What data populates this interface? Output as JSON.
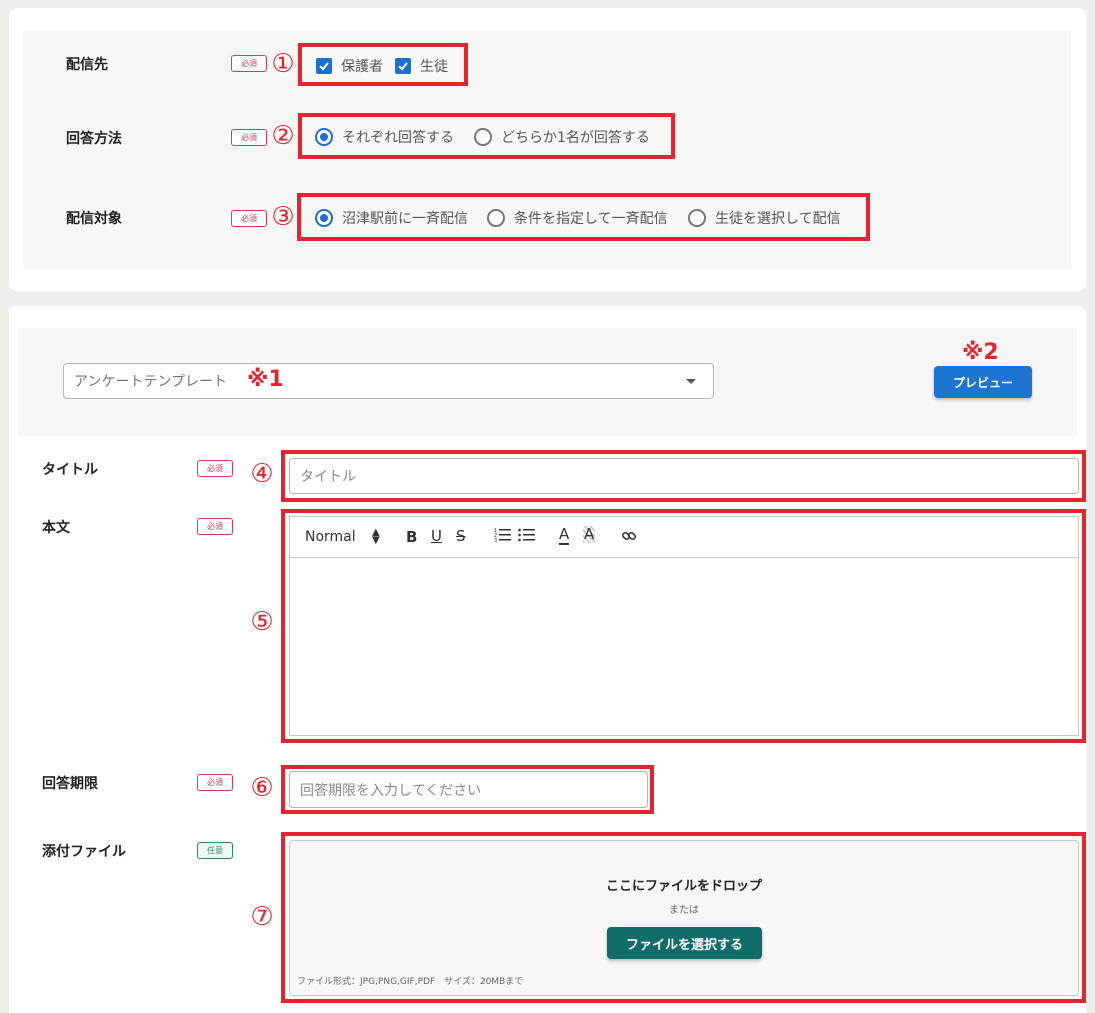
{
  "section1": {
    "rows": [
      {
        "label": "配信先",
        "badge": "必須",
        "num": "①"
      },
      {
        "label": "回答方法",
        "badge": "必須",
        "num": "②"
      },
      {
        "label": "配信対象",
        "badge": "必須",
        "num": "③"
      }
    ],
    "recipients": [
      {
        "label": "保護者",
        "checked": true
      },
      {
        "label": "生徒",
        "checked": true
      }
    ],
    "answer_methods": [
      {
        "label": "それぞれ回答する",
        "selected": true
      },
      {
        "label": "どちらか1名が回答する",
        "selected": false
      }
    ],
    "targets": [
      {
        "label": "沼津駅前に一斉配信",
        "selected": true
      },
      {
        "label": "条件を指定して一斉配信",
        "selected": false
      },
      {
        "label": "生徒を選択して配信",
        "selected": false
      }
    ]
  },
  "template": {
    "placeholder": "アンケートテンプレート",
    "note1": "※1",
    "note2": "※2",
    "preview_label": "プレビュー"
  },
  "form": {
    "title": {
      "label": "タイトル",
      "badge": "必須",
      "num": "④",
      "placeholder": "タイトル"
    },
    "body": {
      "label": "本文",
      "badge": "必須",
      "num": "⑤",
      "font_select": "Normal"
    },
    "deadline": {
      "label": "回答期限",
      "badge": "必須",
      "num": "⑥",
      "placeholder": "回答期限を入力してください"
    },
    "attachment": {
      "label": "添付ファイル",
      "badge": "任意",
      "num": "⑦",
      "drop_text": "ここにファイルをドロップ",
      "or_text": "または",
      "select_label": "ファイルを選択する",
      "format_note": "ファイル形式：JPG,PNG,GIF,PDF　サイズ：20MBまで"
    }
  },
  "colors": {
    "accent": "#1d74d1",
    "required": "#d3395e",
    "optional": "#2b8a6e",
    "highlight": "#e5242f",
    "teal": "#116d6a"
  }
}
